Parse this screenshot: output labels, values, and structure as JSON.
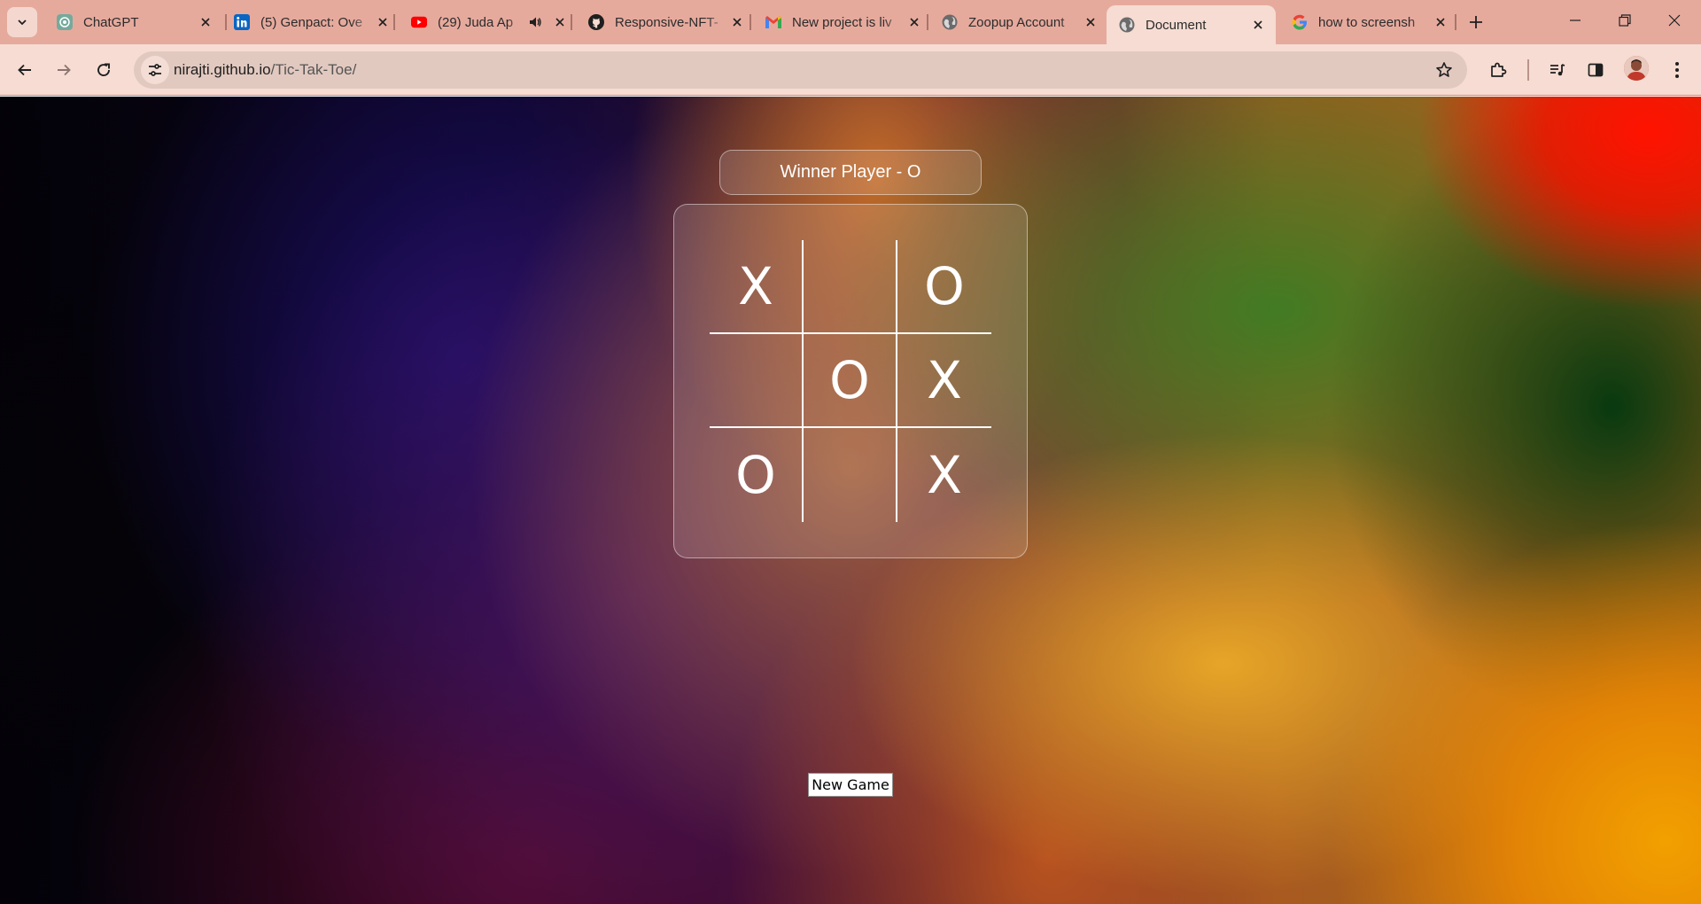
{
  "browser": {
    "tabs": [
      {
        "title": "ChatGPT",
        "icon": "chatgpt-icon",
        "active": false
      },
      {
        "title": "(5) Genpact: Ove",
        "icon": "linkedin-icon",
        "active": false
      },
      {
        "title": "(29) Juda Ap",
        "icon": "youtube-icon",
        "active": false,
        "audio": true
      },
      {
        "title": "Responsive-NFT-",
        "icon": "github-icon",
        "active": false
      },
      {
        "title": "New project is liv",
        "icon": "gmail-icon",
        "active": false
      },
      {
        "title": "Zoopup Account",
        "icon": "globe-icon",
        "active": false
      },
      {
        "title": "Document",
        "icon": "globe-icon",
        "active": true
      },
      {
        "title": "how to screensh",
        "icon": "google-icon",
        "active": false
      }
    ],
    "url_host": "nirajti.github.io",
    "url_path": "/Tic-Tak-Toe/",
    "colors": {
      "tabstrip": "#e6aa9d",
      "toolbar": "#f6dcd2"
    }
  },
  "game": {
    "status": "Winner Player - O",
    "board": [
      "X",
      "",
      "O",
      "",
      "O",
      "X",
      "O",
      "",
      "X"
    ],
    "new_game_label": "New Game"
  }
}
